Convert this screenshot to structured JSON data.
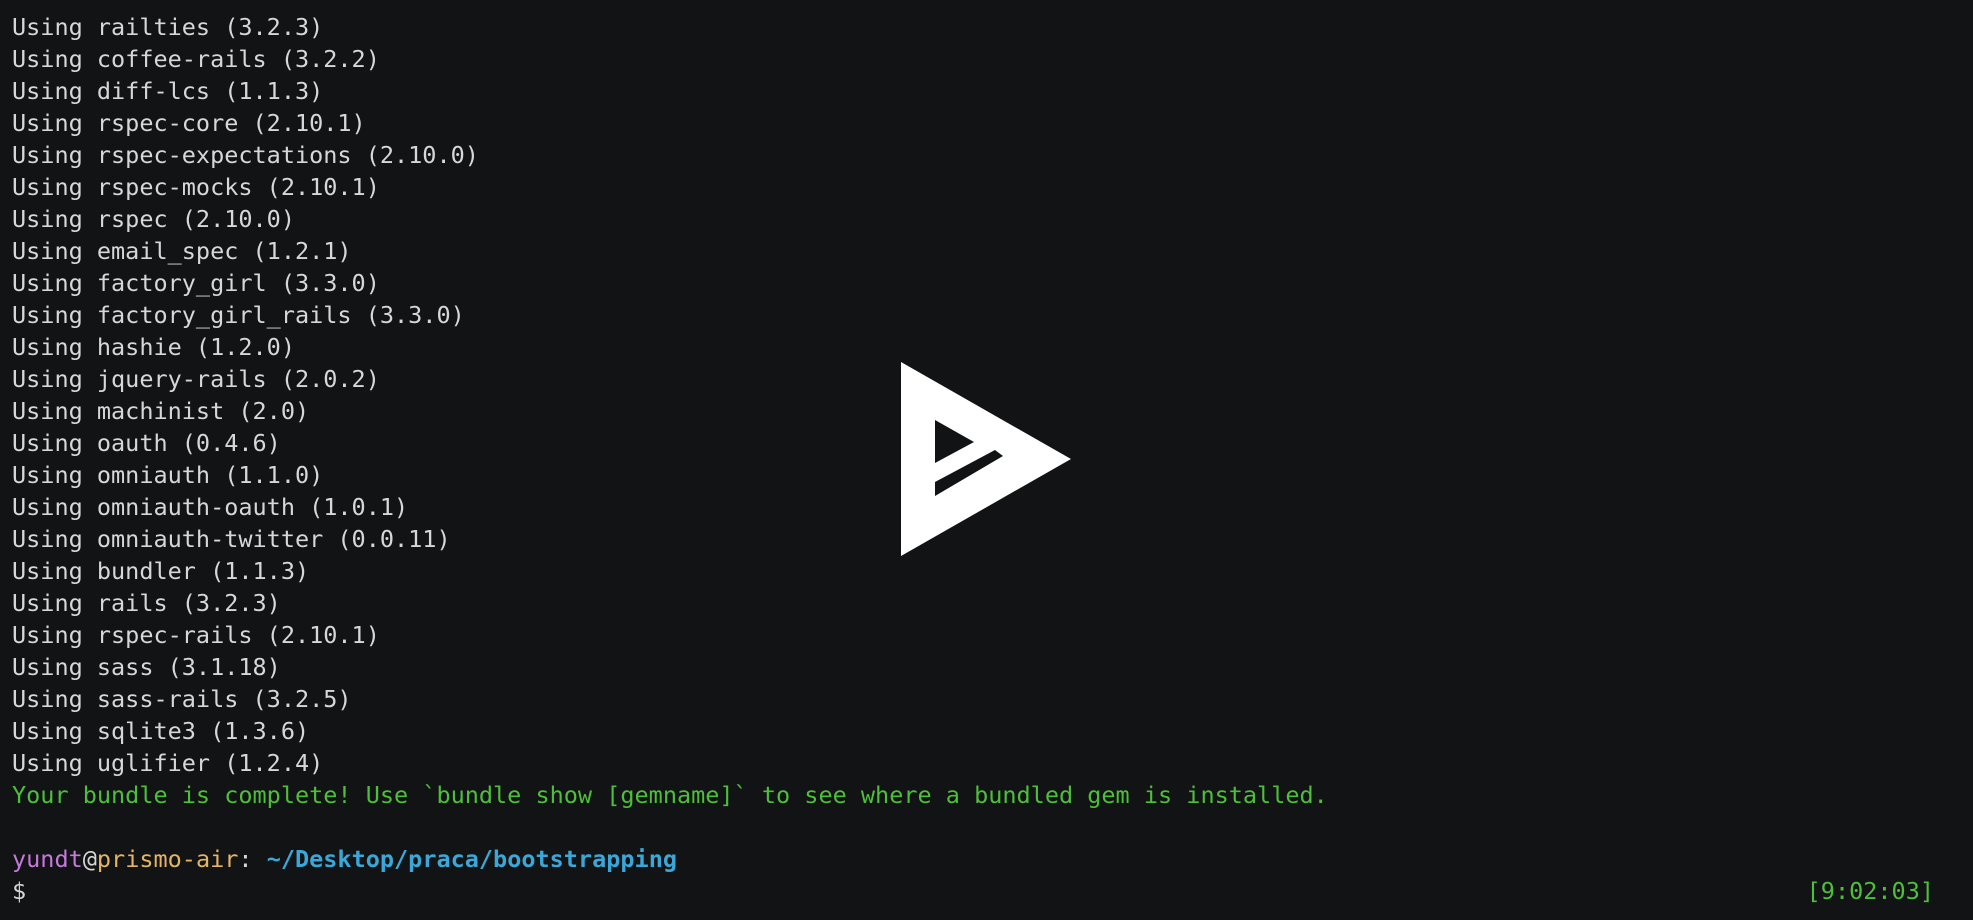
{
  "terminal": {
    "lines": [
      "Using railties (3.2.3)",
      "Using coffee-rails (3.2.2)",
      "Using diff-lcs (1.1.3)",
      "Using rspec-core (2.10.1)",
      "Using rspec-expectations (2.10.0)",
      "Using rspec-mocks (2.10.1)",
      "Using rspec (2.10.0)",
      "Using email_spec (1.2.1)",
      "Using factory_girl (3.3.0)",
      "Using factory_girl_rails (3.3.0)",
      "Using hashie (1.2.0)",
      "Using jquery-rails (2.0.2)",
      "Using machinist (2.0)",
      "Using oauth (0.4.6)",
      "Using omniauth (1.1.0)",
      "Using omniauth-oauth (1.0.1)",
      "Using omniauth-twitter (0.0.11)",
      "Using bundler (1.1.3)",
      "Using rails (3.2.3)",
      "Using rspec-rails (2.10.1)",
      "Using sass (3.1.18)",
      "Using sass-rails (3.2.5)",
      "Using sqlite3 (1.3.6)",
      "Using uglifier (1.2.4)"
    ],
    "success_message": "Your bundle is complete! Use `bundle show [gemname]` to see where a bundled gem is installed.",
    "prompt": {
      "user": "yundt",
      "at": "@",
      "host": "prismo-air",
      "colon": ": ",
      "path": "~/Desktop/praca/bootstrapping",
      "symbol": "$",
      "time": "[9:02:03]"
    }
  },
  "overlay": {
    "icon": "asciinema-play-icon",
    "color": "#ffffff"
  },
  "colors": {
    "background": "#121314",
    "text": "#d7d7d7",
    "success": "#4ebf3a",
    "user": "#c678dd",
    "host": "#e5b567",
    "path": "#3aa7d8"
  }
}
